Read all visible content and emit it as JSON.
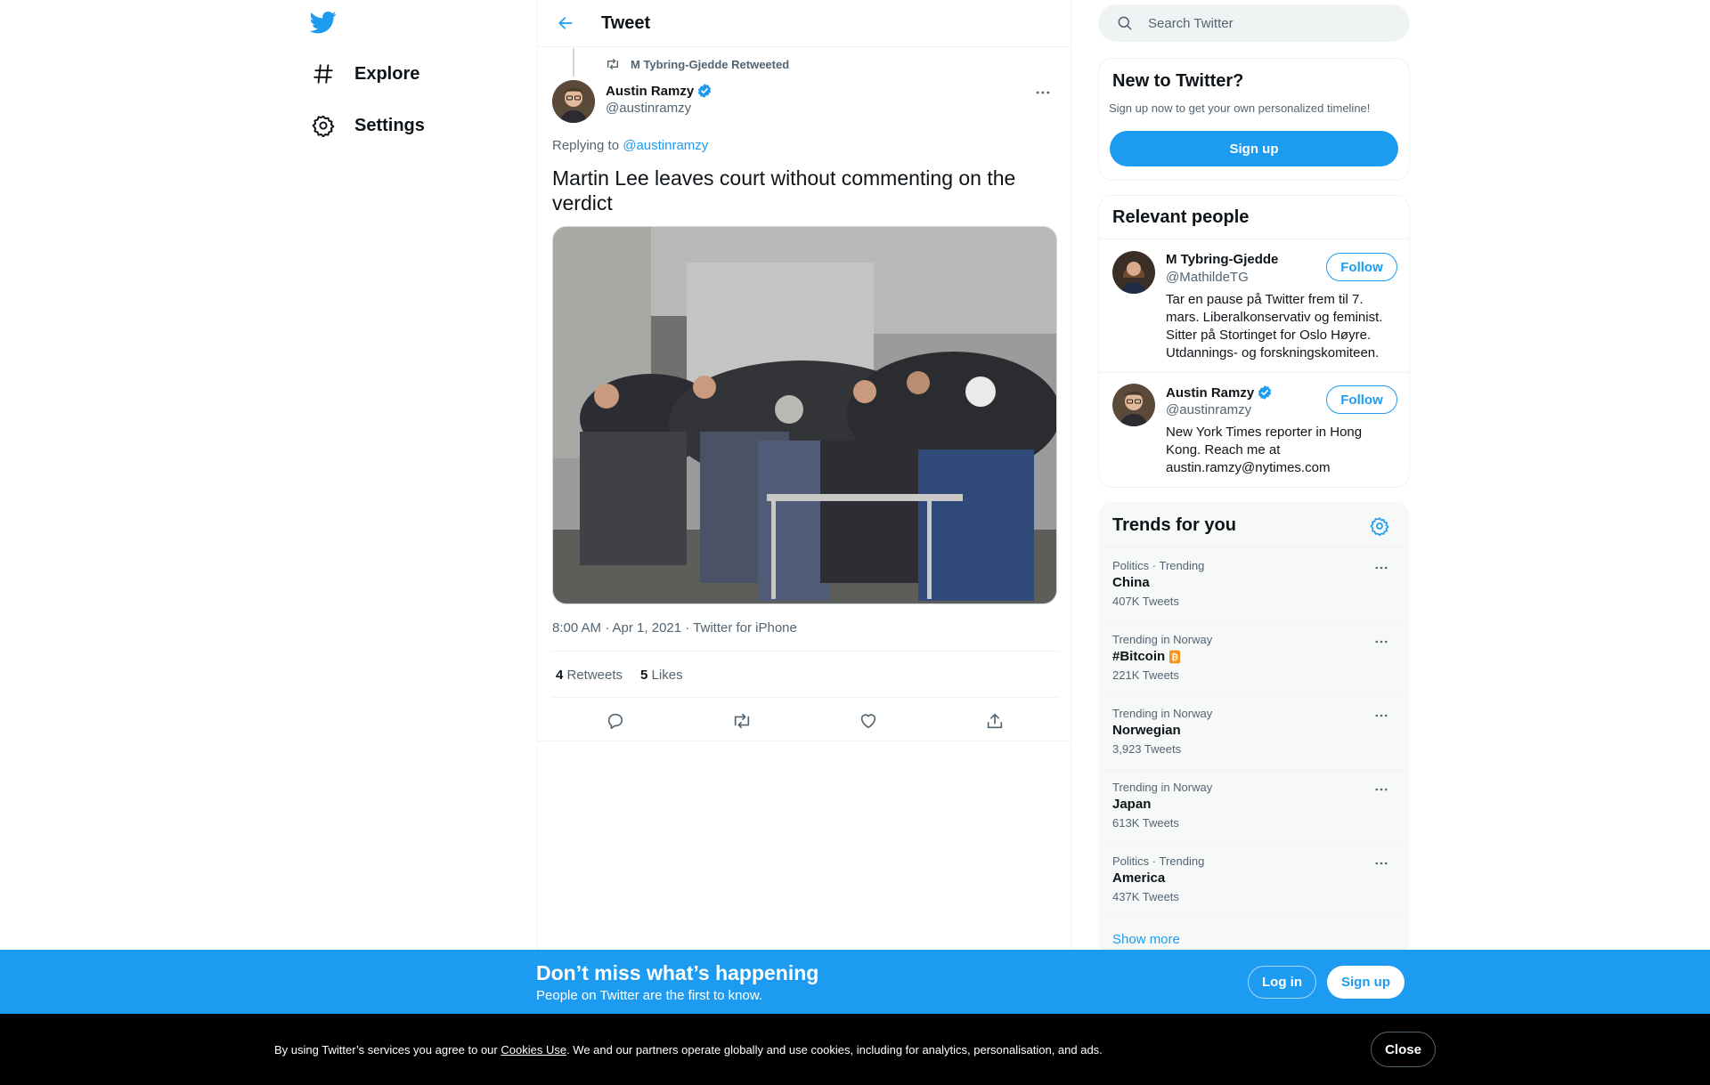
{
  "nav": {
    "items": [
      {
        "label": "Explore",
        "icon": "hashtag-icon"
      },
      {
        "label": "Settings",
        "icon": "gear-icon"
      }
    ]
  },
  "main": {
    "title": "Tweet",
    "retweeted_by": "M Tybring-Gjedde Retweeted",
    "author": {
      "name": "Austin Ramzy",
      "handle": "@austinramzy",
      "verified": true
    },
    "replying_prefix": "Replying to ",
    "replying_to": "@austinramzy",
    "text": "Martin Lee leaves court without commenting on the verdict",
    "meta": "8:00 AM · Apr 1, 2021 · Twitter for iPhone",
    "stats": {
      "retweets_count": "4",
      "retweets_label": " Retweets",
      "likes_count": "5",
      "likes_label": " Likes"
    }
  },
  "search": {
    "placeholder": "Search Twitter"
  },
  "new_to_twitter": {
    "title": "New to Twitter?",
    "subtitle": "Sign up now to get your own personalized timeline!",
    "button": "Sign up"
  },
  "relevant_people": {
    "title": "Relevant people",
    "people": [
      {
        "name": "M Tybring-Gjedde",
        "handle": "@MathildeTG",
        "bio": "Tar en pause på Twitter frem til 7. mars. Liberalkonservativ og feminist. Sitter på Stortinget for Oslo Høyre. Utdannings- og forskningskomiteen.",
        "button": "Follow",
        "verified": false
      },
      {
        "name": "Austin Ramzy",
        "handle": "@austinramzy",
        "bio": "New York Times reporter in Hong Kong. Reach me at austin.ramzy@nytimes.com",
        "button": "Follow",
        "verified": true
      }
    ]
  },
  "trends": {
    "title": "Trends for you",
    "items": [
      {
        "context": "Politics · Trending",
        "name": "China",
        "count": "407K Tweets"
      },
      {
        "context": "Trending in Norway",
        "name": "#Bitcoin",
        "count": "221K Tweets"
      },
      {
        "context": "Trending in Norway",
        "name": "Norwegian",
        "count": "3,923 Tweets"
      },
      {
        "context": "Trending in Norway",
        "name": "Japan",
        "count": "613K Tweets"
      },
      {
        "context": "Politics · Trending",
        "name": "America",
        "count": "437K Tweets"
      }
    ],
    "show_more": "Show more"
  },
  "bottom_bar": {
    "title": "Don’t miss what’s happening",
    "subtitle": "People on Twitter are the first to know.",
    "login": "Log in",
    "signup": "Sign up"
  },
  "cookie": {
    "text_before": "By using Twitter’s services you agree to our ",
    "link": "Cookies Use",
    "text_after": ". We and our partners operate globally and use cookies, including for analytics, personalisation, and ads.",
    "close": "Close"
  },
  "colors": {
    "accent": "#1d9bf0",
    "text": "#0f1419",
    "secondary": "#536471"
  }
}
